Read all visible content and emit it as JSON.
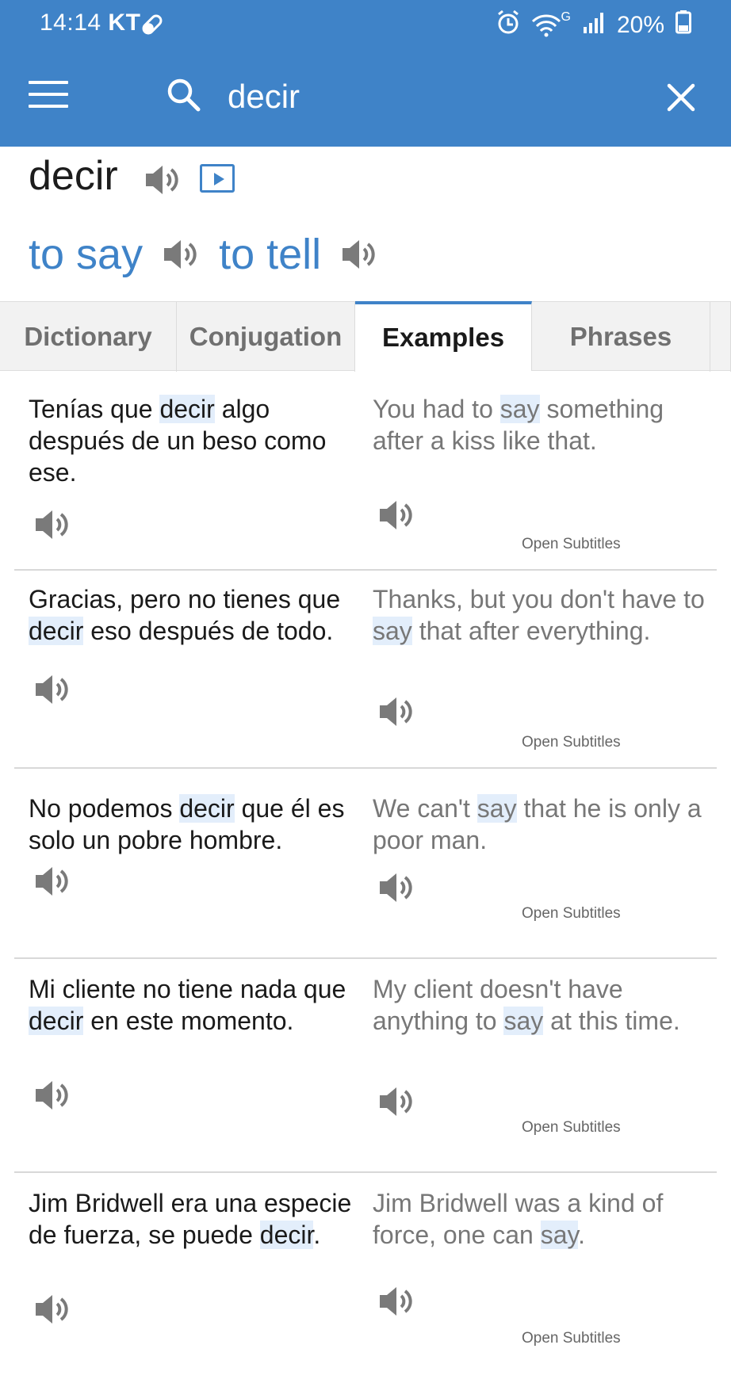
{
  "status_bar": {
    "time": "14:14",
    "carrier": "KT",
    "network": "G",
    "battery": "20%"
  },
  "search": {
    "value": "decir",
    "placeholder": ""
  },
  "word": {
    "headword": "decir",
    "translations": [
      "to say",
      "to tell"
    ]
  },
  "tabs": [
    {
      "label": "Dictionary",
      "active": false
    },
    {
      "label": "Conjugation",
      "active": false
    },
    {
      "label": "Examples",
      "active": true
    },
    {
      "label": "Phrases",
      "active": false
    }
  ],
  "examples": [
    {
      "spanish": {
        "before": "Tenías que ",
        "highlight": "decir",
        "after": " algo después de un beso como ese."
      },
      "english": {
        "before": "You had to ",
        "highlight": "say",
        "after": " something after a kiss like that."
      },
      "source": "Open Subtitles"
    },
    {
      "spanish": {
        "before": "Gracias, pero no tienes que ",
        "highlight": "decir",
        "after": " eso después de todo."
      },
      "english": {
        "before": "Thanks, but you don't have to ",
        "highlight": "say",
        "after": " that after everything."
      },
      "source": "Open Subtitles"
    },
    {
      "spanish": {
        "before": "No podemos ",
        "highlight": "decir",
        "after": " que él es solo un pobre hombre."
      },
      "english": {
        "before": "We can't ",
        "highlight": "say",
        "after": " that he is only a poor man."
      },
      "source": "Open Subtitles"
    },
    {
      "spanish": {
        "before": "Mi cliente no tiene nada que ",
        "highlight": "decir",
        "after": " en este momento."
      },
      "english": {
        "before": "My client doesn't have anything to ",
        "highlight": "say",
        "after": " at this time."
      },
      "source": "Open Subtitles"
    },
    {
      "spanish": {
        "before": "Jim Bridwell era una especie de fuerza, se puede ",
        "highlight": "decir",
        "after": "."
      },
      "english": {
        "before": "Jim Bridwell was a kind of force, one can ",
        "highlight": "say",
        "after": "."
      },
      "source": "Open Subtitles"
    }
  ],
  "colors": {
    "brand": "#3f83c8",
    "highlight": "#e3eefb"
  },
  "icons": [
    "menu-icon",
    "search-icon",
    "close-icon",
    "speaker-icon",
    "video-play-icon",
    "alarm-icon",
    "wifi-icon",
    "signal-icon",
    "battery-icon"
  ]
}
